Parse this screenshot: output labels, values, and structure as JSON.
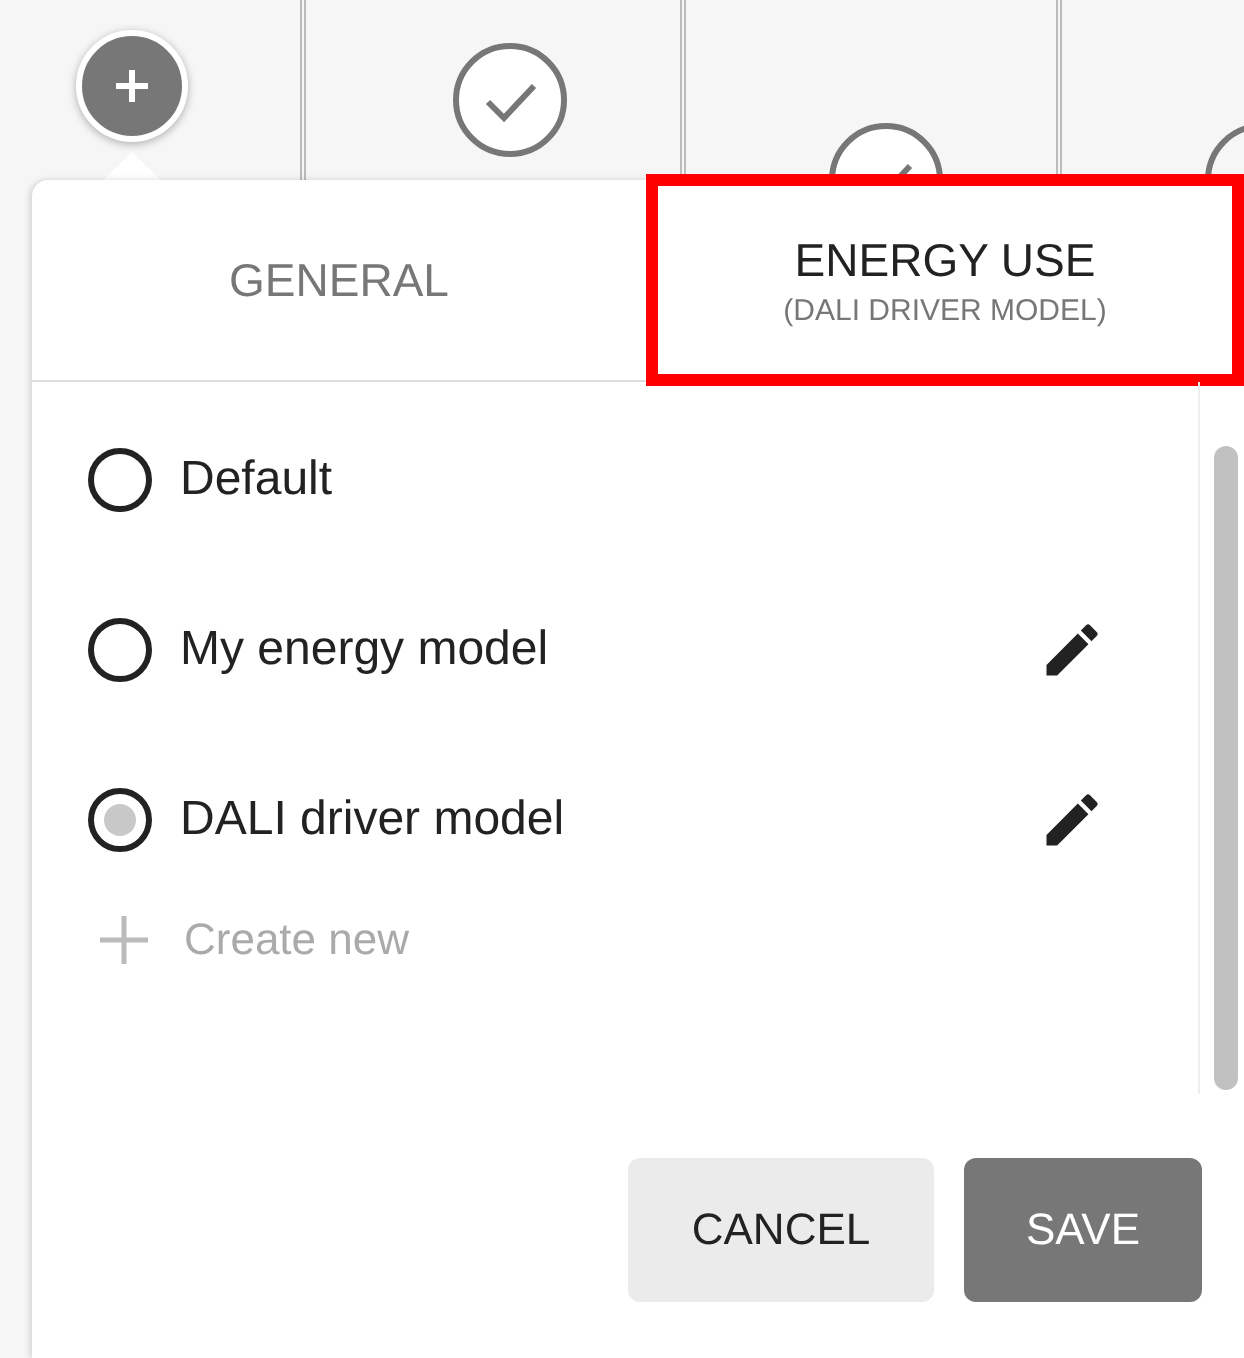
{
  "tabs": [
    {
      "label": "GENERAL",
      "selected": false
    },
    {
      "label": "ENERGY USE",
      "sublabel": "(DALI DRIVER MODEL)",
      "selected": true
    }
  ],
  "options": [
    {
      "label": "Default",
      "selected": false,
      "editable": false
    },
    {
      "label": "My energy model",
      "selected": false,
      "editable": true
    },
    {
      "label": "DALI driver model",
      "selected": true,
      "editable": true
    }
  ],
  "create_new": "Create new",
  "buttons": [
    {
      "label": "CANCEL",
      "kind": "secondary"
    },
    {
      "label": "SAVE",
      "kind": "primary"
    }
  ]
}
